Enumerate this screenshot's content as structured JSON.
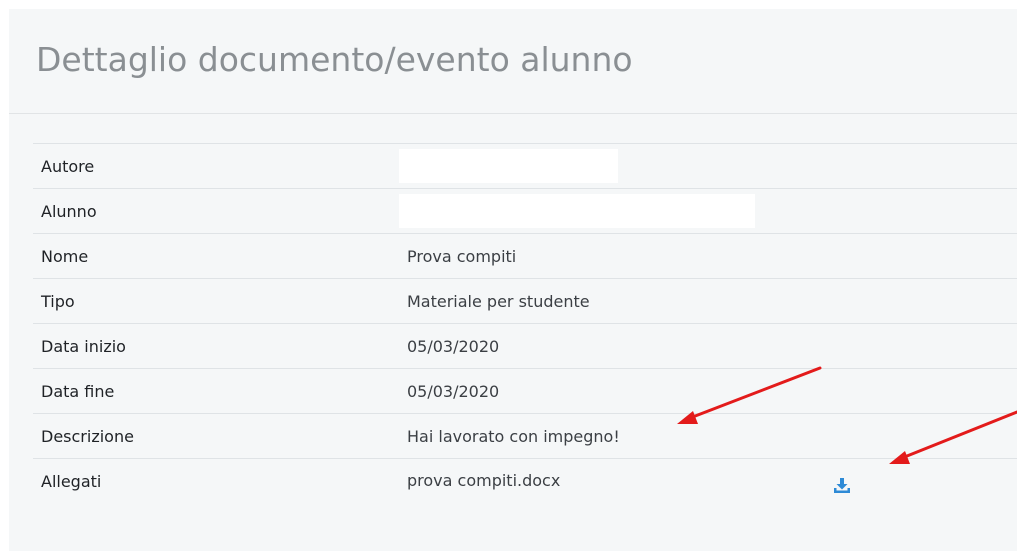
{
  "page": {
    "title": "Dettaglio documento/evento alunno"
  },
  "details": {
    "rows": [
      {
        "label": "Autore",
        "value": ""
      },
      {
        "label": "Alunno",
        "value": ""
      },
      {
        "label": "Nome",
        "value": "Prova compiti"
      },
      {
        "label": "Tipo",
        "value": "Materiale per studente"
      },
      {
        "label": "Data inizio",
        "value": "05/03/2020"
      },
      {
        "label": "Data fine",
        "value": "05/03/2020"
      },
      {
        "label": "Descrizione",
        "value": "Hai lavorato con impegno!"
      },
      {
        "label": "Allegati",
        "value": "prova compiti.docx"
      }
    ]
  },
  "icons": {
    "download": "download-icon",
    "annotation": "red-arrow"
  },
  "colors": {
    "panel_background": "#f5f7f8",
    "title_text": "#8a8f93",
    "download_icon": "#2d8ad6",
    "annotation_arrow": "#e31b1b"
  }
}
